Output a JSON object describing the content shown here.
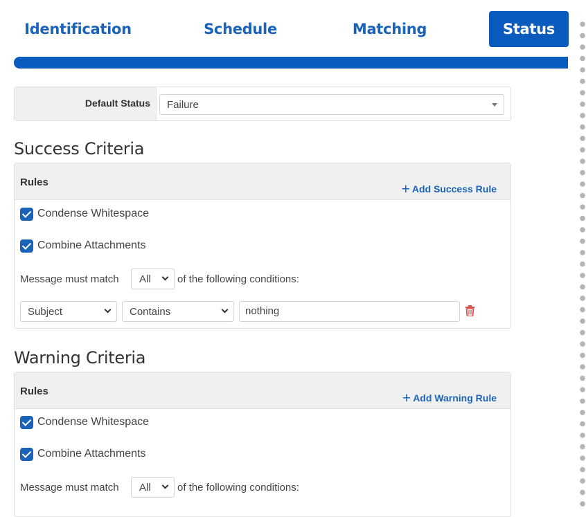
{
  "tabs": [
    {
      "label": "Identification",
      "active": false
    },
    {
      "label": "Schedule",
      "active": false
    },
    {
      "label": "Matching",
      "active": false
    },
    {
      "label": "Status",
      "active": true
    }
  ],
  "progress": {
    "fraction": 1.0
  },
  "default_status": {
    "label": "Default Status",
    "value": "Failure"
  },
  "success": {
    "title": "Success Criteria",
    "rules_label": "Rules",
    "add_rule_label": "Add Success Rule",
    "condense_whitespace": {
      "label": "Condense Whitespace",
      "checked": true
    },
    "combine_attachments": {
      "label": "Combine Attachments",
      "checked": true
    },
    "match_prefix": "Message must match",
    "match_value": "All",
    "match_suffix": "of the following conditions:",
    "condition": {
      "field": "Subject",
      "operator": "Contains",
      "value": "nothing"
    }
  },
  "warning": {
    "title": "Warning Criteria",
    "rules_label": "Rules",
    "add_rule_label": "Add Warning Rule",
    "condense_whitespace": {
      "label": "Condense Whitespace",
      "checked": true
    },
    "combine_attachments": {
      "label": "Combine Attachments",
      "checked": true
    },
    "match_prefix": "Message must match",
    "match_value": "All",
    "match_suffix": "of the following conditions:"
  },
  "colors": {
    "accent": "#0b5bbf",
    "link": "#1b63b8",
    "danger": "#d9534f"
  }
}
